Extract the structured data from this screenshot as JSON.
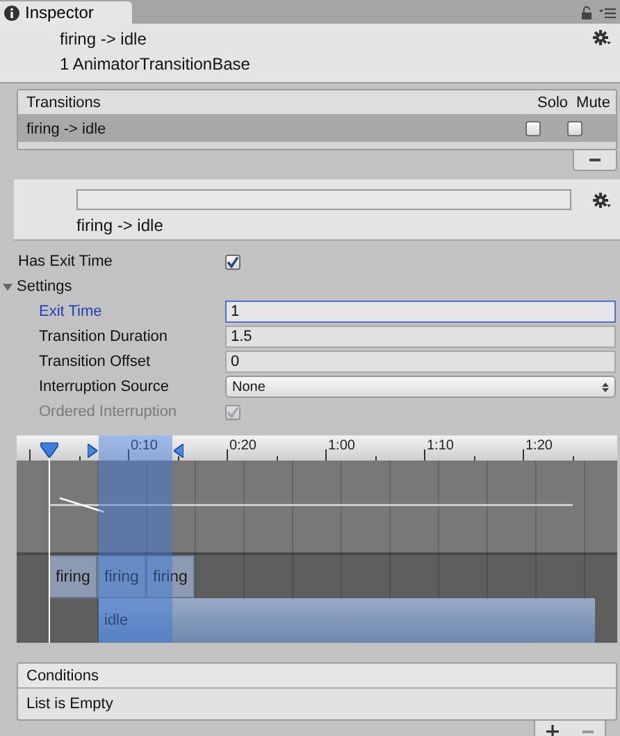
{
  "window": {
    "tab": "Inspector"
  },
  "header": {
    "title": "firing -> idle",
    "subtitle": "1 AnimatorTransitionBase"
  },
  "transitions": {
    "title": "Transitions",
    "columns": [
      "Solo",
      "Mute"
    ],
    "rows": [
      {
        "name": "firing -> idle",
        "selected": true,
        "solo": false,
        "mute": false
      }
    ]
  },
  "transition": {
    "label": "firing -> idle"
  },
  "has_exit_time": {
    "label": "Has Exit Time",
    "checked": true
  },
  "settings": {
    "label": "Settings",
    "expanded": true,
    "fields": [
      {
        "kind": "number",
        "label": "Exit Time",
        "value": "1",
        "focused": true,
        "disabled": false
      },
      {
        "kind": "number",
        "label": "Transition Duration",
        "value": "1.5",
        "focused": false,
        "disabled": false
      },
      {
        "kind": "number",
        "label": "Transition Offset",
        "value": "0",
        "focused": false,
        "disabled": false
      },
      {
        "kind": "dropdown",
        "label": "Interruption Source",
        "value": "None",
        "focused": false,
        "disabled": false
      },
      {
        "kind": "checkbox",
        "label": "Ordered Interruption",
        "checked": true,
        "focused": false,
        "disabled": true
      }
    ]
  },
  "timeline": {
    "ticks": [
      "0:10",
      "0:20",
      "1:00",
      "1:10",
      "1:20"
    ],
    "source_clips": [
      {
        "label": "firing"
      },
      {
        "label": "firing"
      },
      {
        "label": "firing"
      }
    ],
    "target_clip": {
      "label": "idle"
    }
  },
  "conditions": {
    "title": "Conditions",
    "empty_text": "List is Empty"
  }
}
